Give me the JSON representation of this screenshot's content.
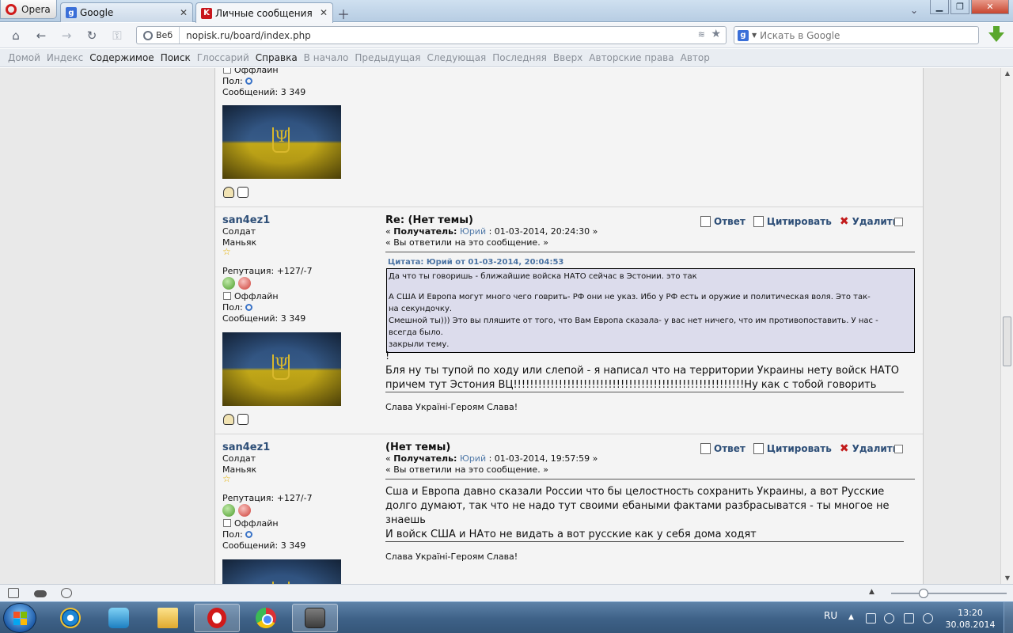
{
  "browser": {
    "menu_label": "Opera",
    "tabs": [
      {
        "label": "Google",
        "favicon": "g-icon",
        "active": false
      },
      {
        "label": "Личные сообщения",
        "favicon": "kk-icon",
        "active": true
      }
    ],
    "address": {
      "mode": "Веб",
      "url": "nopisk.ru/board/index.php"
    },
    "search": {
      "placeholder": "Искать в Google"
    }
  },
  "toolbar": {
    "items": [
      {
        "label": "Домой",
        "enabled": false
      },
      {
        "label": "Индекс",
        "enabled": false
      },
      {
        "label": "Содержимое",
        "enabled": true
      },
      {
        "label": "Поиск",
        "enabled": true
      },
      {
        "label": "Глоссарий",
        "enabled": false
      },
      {
        "label": "Справка",
        "enabled": true
      },
      {
        "label": "В начало",
        "enabled": false
      },
      {
        "label": "Предыдущая",
        "enabled": false
      },
      {
        "label": "Следующая",
        "enabled": false
      },
      {
        "label": "Последняя",
        "enabled": false
      },
      {
        "label": "Вверх",
        "enabled": false
      },
      {
        "label": "Авторские права",
        "enabled": false
      },
      {
        "label": "Автор",
        "enabled": false
      }
    ]
  },
  "common": {
    "offline": "Оффлайн",
    "gender": "Пол:",
    "messages": "Сообщений: 3 349",
    "reply": "Ответ",
    "quote": "Цитировать",
    "delete": "Удалить",
    "signature": "Слава Україні-Героям Слава!",
    "recipient_label": "Получатель:",
    "answered": "« Вы ответили на это сообщение. »"
  },
  "posts": [
    {
      "username": "san4ez1",
      "rank": "Солдат",
      "title2": "Маньяк",
      "reputation": "Репутация: +127/-7",
      "subject": "Re: (Нет темы)",
      "recipient": "Юрий",
      "date": ": 01-03-2014, 20:24:30 »",
      "quote_header": "Цитата: Юрий от 01-03-2014, 20:04:53",
      "quote_lines": [
        "Да что ты говоришь - ближайшие войска НАТО сейчас в Эстонии. это так",
        "А США И Европа могут много чего говрить- РФ они не указ. Ибо у РФ есть и оружие и политическая воля. Это так-",
        "на секундочку.",
        "Смешной ты))) Это вы пляшите от того, что Вам Европа сказала- у вас нет ничего, что им противопоставить. У нас -",
        "всегда было.",
        "закрыли тему."
      ],
      "body_lines": [
        "!",
        "Бля ну ты тупой по ходу или слепой - я написал что на территории Украины нету войск НАТО",
        "причем тут Эстония ВЦ!!!!!!!!!!!!!!!!!!!!!!!!!!!!!!!!!!!!!!!!!!!!!!!!!!!!!!!!Ну как с тобой говорить"
      ]
    },
    {
      "username": "san4ez1",
      "rank": "Солдат",
      "title2": "Маньяк",
      "reputation": "Репутация: +127/-7",
      "subject": "(Нет темы)",
      "recipient": "Юрий",
      "date": ": 01-03-2014, 19:57:59 »",
      "body_lines": [
        "Сша и Европа давно сказали России что бы целостность сохранить Украины, а вот Русские",
        "долго думают, так что не надо тут своими ебаными фактами разбрасыватся - ты многое не",
        "знаешь",
        "И войск США и НАто не видать а вот русские как у себя дома ходят"
      ]
    }
  ],
  "taskbar": {
    "language": "RU",
    "time": "13:20",
    "date": "30.08.2014"
  },
  "colors": {
    "accent": "#2d4e77",
    "link": "#5079a8",
    "quote_bg": "#dcdcec"
  }
}
